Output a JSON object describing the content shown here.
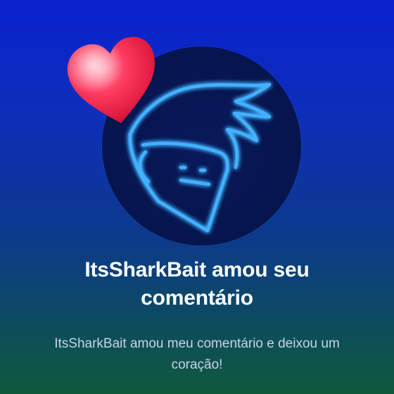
{
  "notification": {
    "title": "ItsSharkBait amou seu comentário",
    "message": "ItsSharkBait amou meu comentário e deixou um coração!"
  },
  "icons": {
    "reaction": "heart-icon",
    "avatar": "neon-face-avatar"
  },
  "colors": {
    "background_top": "#0a21d0",
    "background_bottom": "#0f5a3a",
    "neon": "#39a6ff",
    "heart": "#ff2d55"
  }
}
